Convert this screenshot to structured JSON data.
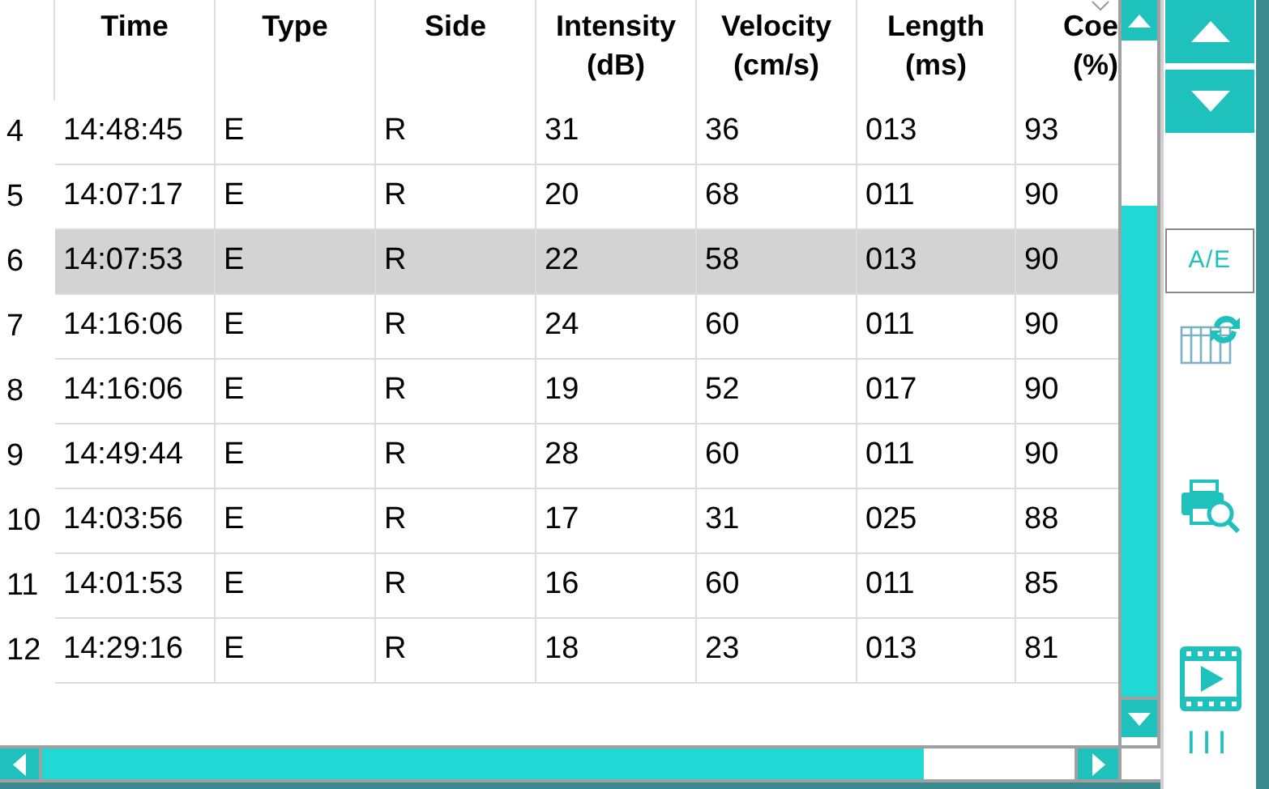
{
  "table": {
    "columns": [
      {
        "label": "Time"
      },
      {
        "label": "Type"
      },
      {
        "label": "Side"
      },
      {
        "label": "Intensity\n(dB)"
      },
      {
        "label": "Velocity\n(cm/s)"
      },
      {
        "label": "Length\n(ms)"
      },
      {
        "label": "Coe\n(%)"
      }
    ],
    "rows": [
      {
        "number": "4",
        "cells": [
          "14:48:45",
          "E",
          "R",
          "31",
          "36",
          "013",
          "93"
        ],
        "selected": false
      },
      {
        "number": "5",
        "cells": [
          "14:07:17",
          "E",
          "R",
          "20",
          "68",
          "011",
          "90"
        ],
        "selected": false
      },
      {
        "number": "6",
        "cells": [
          "14:07:53",
          "E",
          "R",
          "22",
          "58",
          "013",
          "90"
        ],
        "selected": true
      },
      {
        "number": "7",
        "cells": [
          "14:16:06",
          "E",
          "R",
          "24",
          "60",
          "011",
          "90"
        ],
        "selected": false
      },
      {
        "number": "8",
        "cells": [
          "14:16:06",
          "E",
          "R",
          "19",
          "52",
          "017",
          "90"
        ],
        "selected": false
      },
      {
        "number": "9",
        "cells": [
          "14:49:44",
          "E",
          "R",
          "28",
          "60",
          "011",
          "90"
        ],
        "selected": false
      },
      {
        "number": "10",
        "cells": [
          "14:03:56",
          "E",
          "R",
          "17",
          "31",
          "025",
          "88"
        ],
        "selected": false
      },
      {
        "number": "11",
        "cells": [
          "14:01:53",
          "E",
          "R",
          "16",
          "60",
          "011",
          "85"
        ],
        "selected": false
      },
      {
        "number": "12",
        "cells": [
          "14:29:16",
          "E",
          "R",
          "18",
          "23",
          "013",
          "81"
        ],
        "selected": false
      }
    ]
  },
  "side_panel": {
    "mode_button": "A/E",
    "menu_label": "III"
  }
}
